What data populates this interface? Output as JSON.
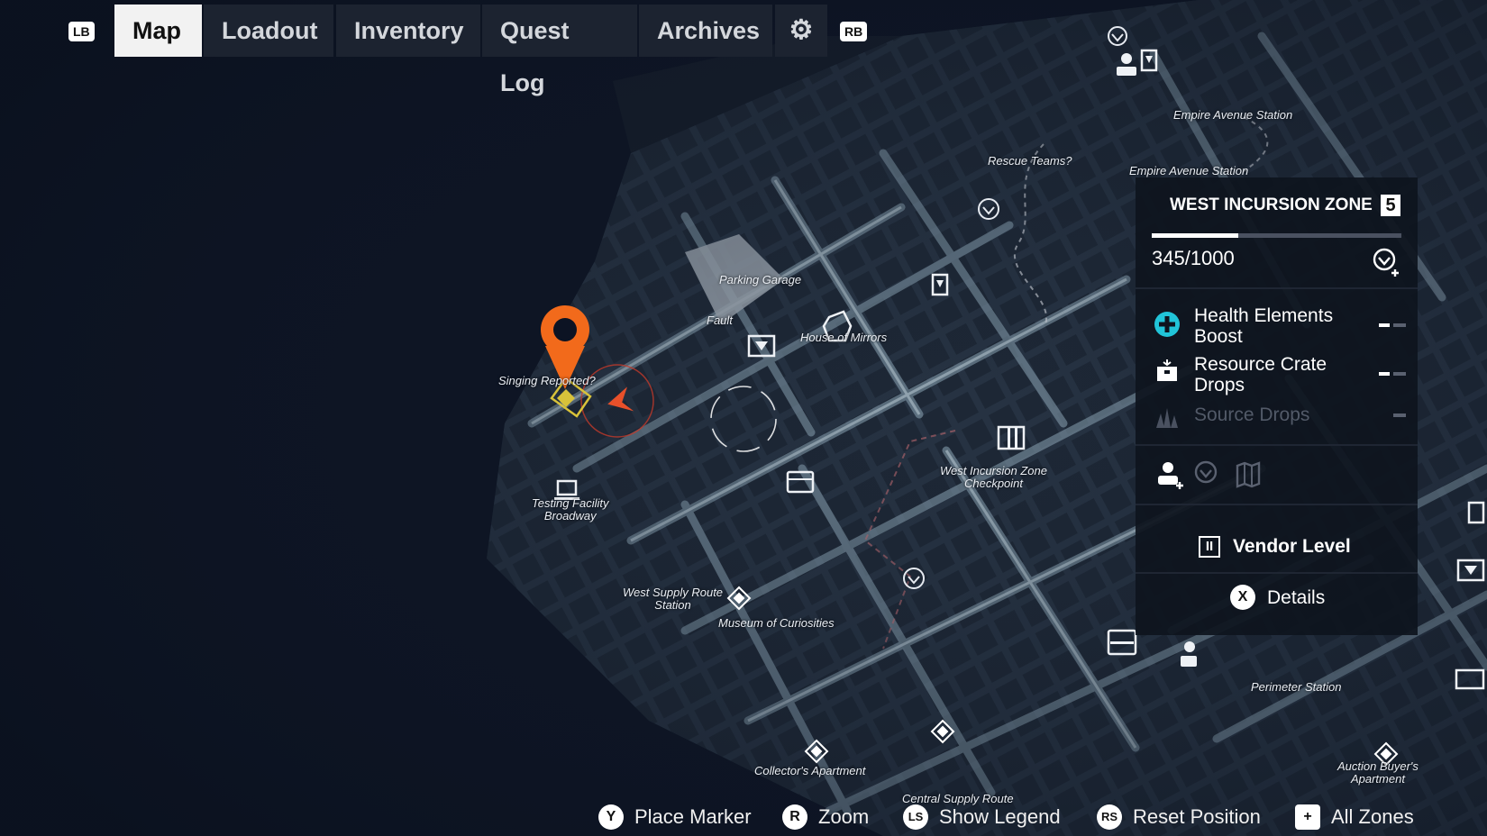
{
  "nav": {
    "lb": "LB",
    "rb": "RB",
    "tabs": [
      "Map",
      "Loadout",
      "Inventory",
      "Quest Log",
      "Archives"
    ],
    "active_tab": "Map"
  },
  "map": {
    "labels": {
      "empire_avenue_station_1": "Empire Avenue Station",
      "empire_avenue_station_2": "Empire Avenue Station",
      "rescue_teams": "Rescue Teams?",
      "parking_garage": "Parking Garage",
      "fault": "Fault",
      "house_of_mirrors": "House of Mirrors",
      "singing_reported": "Singing Reported?",
      "testing_facility": "Testing Facility\nBroadway",
      "west_incursion_checkpoint": "West Incursion Zone\nCheckpoint",
      "west_supply_route": "West Supply Route\nStation",
      "museum_of_curiosities": "Museum of Curiosities",
      "perimeter_station": "Perimeter Station",
      "collectors_apartment": "Collector's Apartment",
      "central_supply_route": "Central Supply Route",
      "auction_buyers_apartment": "Auction Buyer's\nApartment"
    }
  },
  "zone_panel": {
    "title": "WEST INCURSION ZONE",
    "level": "5",
    "progress_text": "345/1000",
    "progress_value": 0.345,
    "stats": [
      {
        "label": "Health Elements Boost",
        "icon": "health-plus-icon"
      },
      {
        "label": "Resource Crate Drops",
        "icon": "resource-crate-icon"
      },
      {
        "label": "Source Drops",
        "icon": "source-drops-icon"
      }
    ],
    "vendor_label": "Vendor Level",
    "vendor_rank": "II",
    "details_button": "X",
    "details_label": "Details"
  },
  "hints": [
    {
      "button": "Y",
      "label": "Place Marker"
    },
    {
      "button": "R",
      "label": "Zoom"
    },
    {
      "button": "LS",
      "label": "Show Legend"
    },
    {
      "button": "RS",
      "label": "Reset Position"
    },
    {
      "button": "+",
      "label": "All Zones"
    }
  ],
  "colors": {
    "accent_orange": "#f26a1b",
    "accent_cyan": "#21c4d8",
    "objective_yellow": "#d8c23a",
    "player_red": "#e8502a"
  }
}
